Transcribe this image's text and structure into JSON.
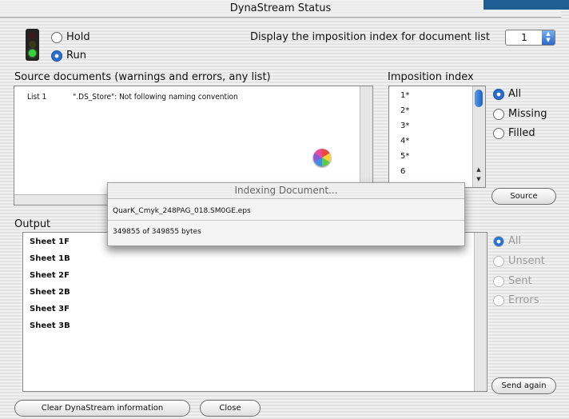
{
  "window": {
    "title": "DynaStream Status"
  },
  "mode": {
    "hold_label": "Hold",
    "run_label": "Run",
    "selected": "Run"
  },
  "imposition_selector": {
    "label": "Display the imposition index for document list",
    "value": "1"
  },
  "source": {
    "heading": "Source documents (warnings and errors, any list)",
    "rows": [
      {
        "list": "List 1",
        "message": "\".DS_Store\": Not following naming convention"
      }
    ]
  },
  "imposition": {
    "heading": "Imposition index",
    "items": [
      "1*",
      "2*",
      "3*",
      "4*",
      "5*",
      "6"
    ],
    "filters": [
      "All",
      "Missing",
      "Filled"
    ],
    "selected_filter": "All",
    "source_button": "Source"
  },
  "output": {
    "heading": "Output",
    "rows": [
      "Sheet 1F",
      "Sheet 1B",
      "Sheet 2F",
      "Sheet 2B",
      "Sheet 3F",
      "Sheet 3B"
    ],
    "filters": [
      "All",
      "Unsent",
      "Sent",
      "Errors"
    ],
    "selected_filter": "All",
    "send_again_button": "Send again"
  },
  "dialog": {
    "title": "Indexing Document...",
    "filename": "QuarK_Cmyk_248PAG_018.SM0GE.eps",
    "progress_text": "349855 of 349855 bytes"
  },
  "footer": {
    "clear_button": "Clear DynaStream information",
    "close_button": "Close"
  }
}
